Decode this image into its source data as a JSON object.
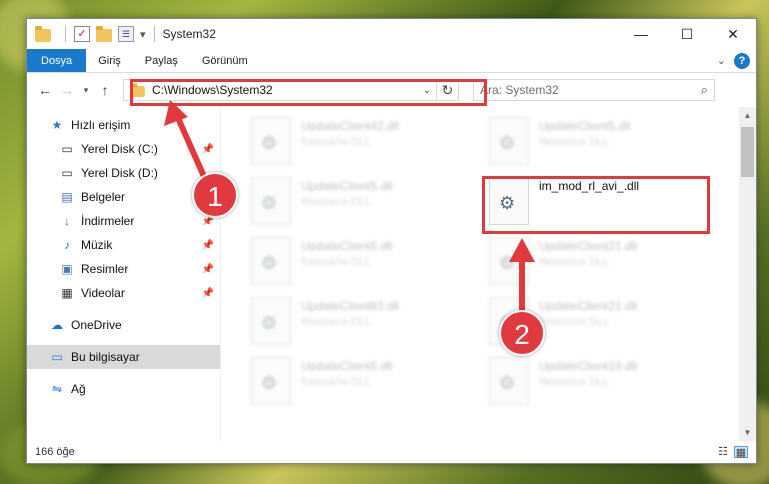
{
  "window": {
    "title": "System32",
    "controls": {
      "minimize": "—",
      "maximize": "☐",
      "close": "✕"
    }
  },
  "ribbon": {
    "tabs": [
      "Dosya",
      "Giriş",
      "Paylaş",
      "Görünüm"
    ],
    "help": "?"
  },
  "navbar": {
    "address": "C:\\Windows\\System32",
    "search_placeholder": "Ara: System32"
  },
  "sidebar": {
    "quick_access": "Hızlı erişim",
    "items": [
      {
        "label": "Yerel Disk (C:)",
        "icon": "drive-icon",
        "pinned": true
      },
      {
        "label": "Yerel Disk (D:)",
        "icon": "drive-icon",
        "pinned": false
      },
      {
        "label": "Belgeler",
        "icon": "documents-icon",
        "pinned": true
      },
      {
        "label": "İndirmeler",
        "icon": "download-icon",
        "pinned": true
      },
      {
        "label": "Müzik",
        "icon": "music-icon",
        "pinned": true
      },
      {
        "label": "Resimler",
        "icon": "pictures-icon",
        "pinned": true
      },
      {
        "label": "Videolar",
        "icon": "videos-icon",
        "pinned": true
      }
    ],
    "onedrive": "OneDrive",
    "this_pc": "Bu bilgisayar",
    "network": "Ağ"
  },
  "files": {
    "left_column": [
      {
        "name": "UpdateClient42.dll",
        "type": "Resource DLL"
      },
      {
        "name": "UpdateClient5.dll",
        "type": "Resource DLL"
      },
      {
        "name": "UpdateClient5.dll",
        "type": "Resource DLL"
      },
      {
        "name": "UpdateClient63.dll",
        "type": "Resource DLL"
      },
      {
        "name": "UpdateClient5.dll",
        "type": "Resource DLL"
      }
    ],
    "right_column": [
      {
        "name": "UpdateClient5.dll",
        "type": "Resource DLL"
      },
      {
        "name": "im_mod_rl_avi_.dll",
        "type": ""
      },
      {
        "name": "UpdateClient21.dll",
        "type": "Resource DLL"
      },
      {
        "name": "UpdateClient21.dll",
        "type": "Resource DLL"
      },
      {
        "name": "UpdateClient19.dll",
        "type": "Resource DLL"
      }
    ]
  },
  "status": {
    "count": "166 öğe"
  },
  "annotations": {
    "step1": "1",
    "step2": "2",
    "color": "#e0393e"
  }
}
